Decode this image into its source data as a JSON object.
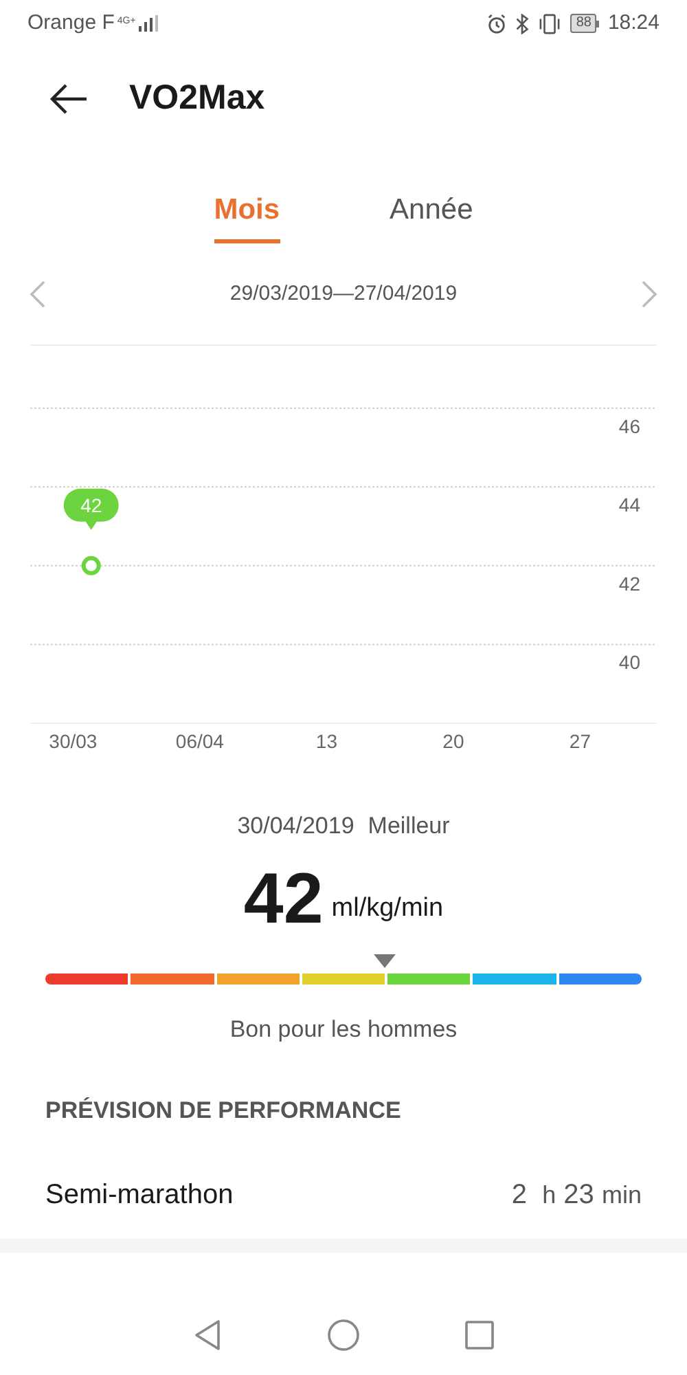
{
  "status_bar": {
    "carrier": "Orange F",
    "network": "4G+",
    "battery": "88",
    "time": "18:24"
  },
  "header": {
    "title": "VO2Max"
  },
  "tabs": [
    {
      "label": "Mois",
      "selected": true
    },
    {
      "label": "Année",
      "selected": false
    }
  ],
  "period": {
    "range": "29/03/2019—27/04/2019"
  },
  "chart_data": {
    "type": "scatter",
    "categories": [
      null,
      "30/03",
      null,
      null,
      null,
      null,
      null,
      null,
      "06/04",
      null,
      null,
      null,
      null,
      null,
      null,
      "13",
      null,
      null,
      null,
      null,
      null,
      null,
      "20",
      null,
      null,
      null,
      null,
      null,
      null,
      "27"
    ],
    "series": [
      {
        "color": "#6cd43f",
        "values": [
          null,
          null,
          42,
          null,
          null,
          null,
          null,
          null,
          null,
          null,
          null,
          null,
          null,
          null,
          null,
          null,
          null,
          null,
          null,
          null,
          null,
          null,
          null,
          null,
          null,
          null,
          null,
          null,
          null,
          null
        ]
      }
    ],
    "ylim": [
      38,
      47.6
    ],
    "yticks": [
      40,
      42,
      44,
      46
    ],
    "grid": true,
    "data_labels": true
  },
  "summary": {
    "date": "30/04/2019",
    "badge": "Meilleur",
    "value": "42",
    "unit": "ml/kg/min",
    "rating": "Bon pour les hommes"
  },
  "performance": {
    "heading": "PRÉVISION DE PERFORMANCE",
    "rows": [
      {
        "label": "Semi-marathon",
        "hours": "2",
        "h_unit": "h",
        "minutes": "23",
        "min_unit": "min"
      }
    ]
  }
}
